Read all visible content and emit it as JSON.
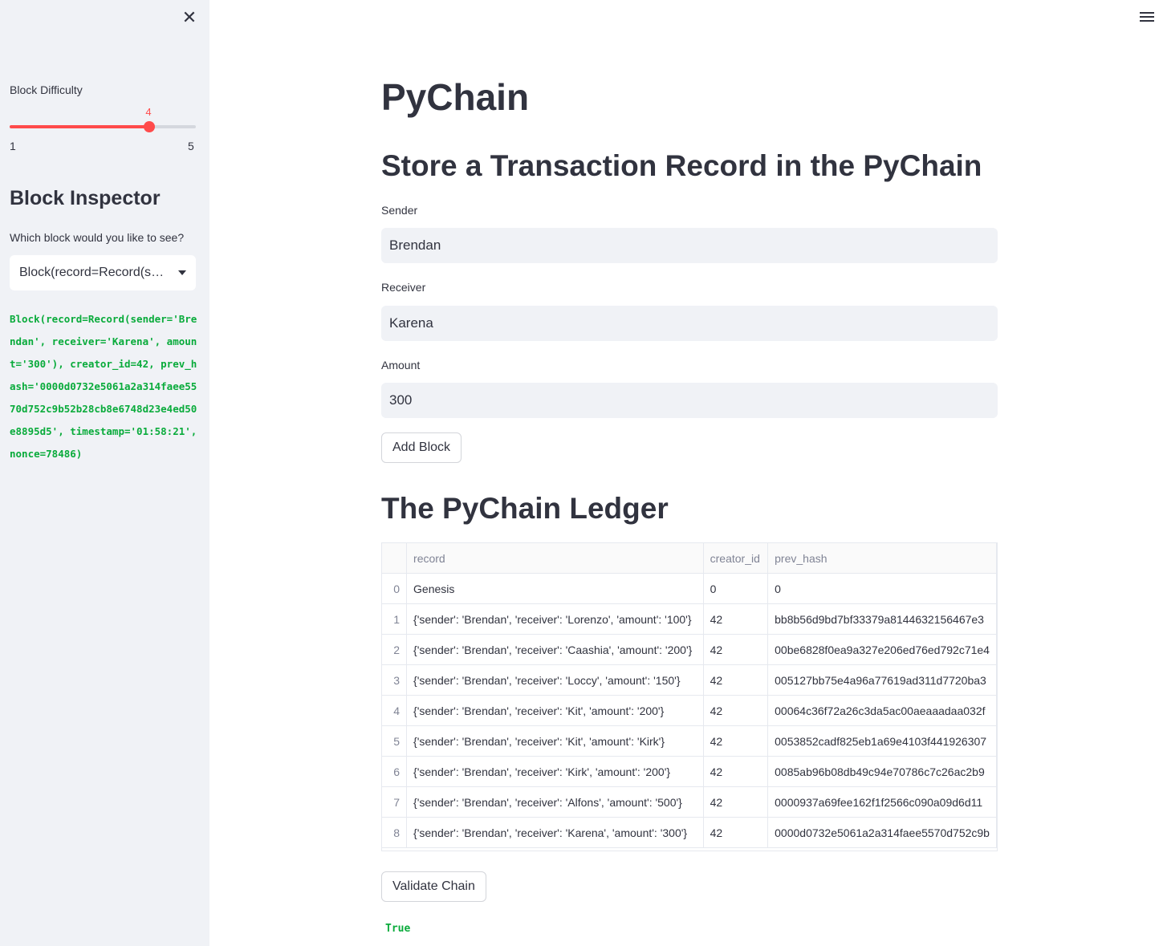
{
  "sidebar": {
    "close_icon": "close-icon",
    "difficulty_label": "Block Difficulty",
    "difficulty_value": "4",
    "difficulty_min": "1",
    "difficulty_max": "5",
    "inspector_heading": "Block Inspector",
    "inspector_question": "Which block would you like to see?",
    "selected_block": "Block(record=Record(sender='Brendan', receiver='Karena', amount='300'), creator_id=42, prev_hash='0000d0732e5061a2a314faee5570d752c9b52b28cb8e6748d23e4ed50e8895d5', timestamp='01:58:21', nonce=78486)",
    "block_output": "Block(record=Record(sender='Brendan', receiver='Karena', amount='300'), creator_id=42, prev_hash='0000d0732e5061a2a314faee5570d752c9b52b28cb8e6748d23e4ed50e8895d5', timestamp='01:58:21', nonce=78486)"
  },
  "menu_icon": "hamburger-menu-icon",
  "main": {
    "title": "PyChain",
    "subtitle": "Store a Transaction Record in the PyChain",
    "sender_label": "Sender",
    "sender_value": "Brendan",
    "receiver_label": "Receiver",
    "receiver_value": "Karena",
    "amount_label": "Amount",
    "amount_value": "300",
    "add_block_label": "Add Block",
    "ledger_title": "The PyChain Ledger",
    "ledger": {
      "columns": [
        "",
        "record",
        "creator_id",
        "prev_hash"
      ],
      "rows": [
        {
          "idx": "0",
          "record": "Genesis",
          "creator_id": "0",
          "prev_hash": "0"
        },
        {
          "idx": "1",
          "record": "{'sender': 'Brendan', 'receiver': 'Lorenzo', 'amount': '100'}",
          "creator_id": "42",
          "prev_hash": "bb8b56d9bd7bf33379a8144632156467e3"
        },
        {
          "idx": "2",
          "record": "{'sender': 'Brendan', 'receiver': 'Caashia', 'amount': '200'}",
          "creator_id": "42",
          "prev_hash": "00be6828f0ea9a327e206ed76ed792c71e4"
        },
        {
          "idx": "3",
          "record": "{'sender': 'Brendan', 'receiver': 'Loccy', 'amount': '150'}",
          "creator_id": "42",
          "prev_hash": "005127bb75e4a96a77619ad311d7720ba3"
        },
        {
          "idx": "4",
          "record": "{'sender': 'Brendan', 'receiver': 'Kit', 'amount': '200'}",
          "creator_id": "42",
          "prev_hash": "00064c36f72a26c3da5ac00aeaaadaa032f"
        },
        {
          "idx": "5",
          "record": "{'sender': 'Brendan', 'receiver': 'Kit', 'amount': 'Kirk'}",
          "creator_id": "42",
          "prev_hash": "0053852cadf825eb1a69e4103f441926307"
        },
        {
          "idx": "6",
          "record": "{'sender': 'Brendan', 'receiver': 'Kirk', 'amount': '200'}",
          "creator_id": "42",
          "prev_hash": "0085ab96b08db49c94e70786c7c26ac2b9"
        },
        {
          "idx": "7",
          "record": "{'sender': 'Brendan', 'receiver': 'Alfons', 'amount': '500'}",
          "creator_id": "42",
          "prev_hash": "0000937a69fee162f1f2566c090a09d6d11"
        },
        {
          "idx": "8",
          "record": "{'sender': 'Brendan', 'receiver': 'Karena', 'amount': '300'}",
          "creator_id": "42",
          "prev_hash": "0000d0732e5061a2a314faee5570d752c9b"
        }
      ]
    },
    "validate_label": "Validate Chain",
    "validate_result": "True"
  },
  "colors": {
    "accent": "#ff4b4b",
    "code_green": "#09ab3b",
    "sidebar_bg": "#f0f2f6",
    "text": "#31333f"
  },
  "slider": {
    "min": 1,
    "max": 5,
    "value": 4
  }
}
